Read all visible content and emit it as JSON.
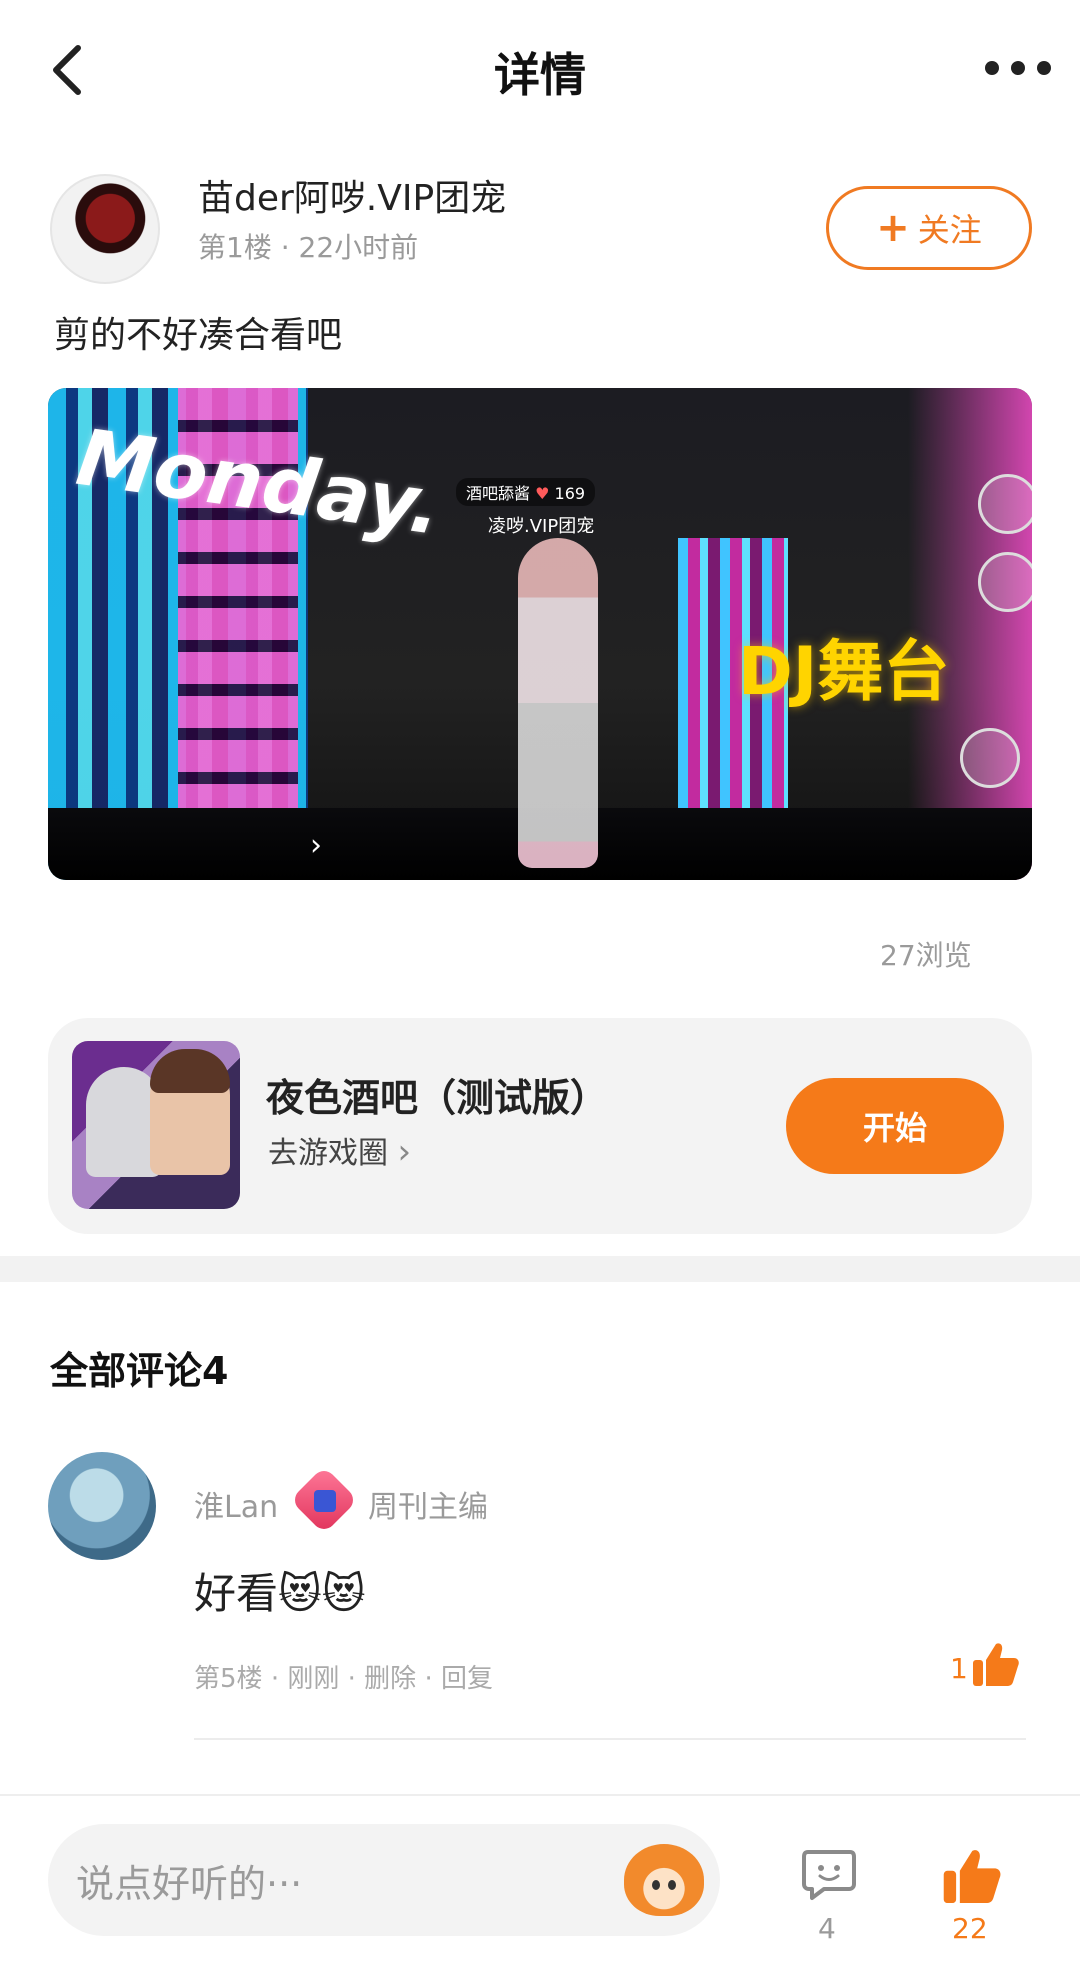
{
  "header": {
    "title": "详情"
  },
  "author": {
    "name": "苗der阿哕.VIP团宠",
    "floor": "第1楼",
    "time": "22小时前",
    "follow_label": "关注"
  },
  "post": {
    "text": "剪的不好凑合看吧",
    "media": {
      "overlay_text": "Monday.",
      "sign_text": "DJ舞台",
      "char_tag": "酒吧舔酱",
      "char_likes": "169",
      "char_name": "凌哕.VIP团宠"
    },
    "views": "27浏览"
  },
  "game": {
    "title": "夜色酒吧（测试版）",
    "link": "去游戏圈",
    "start_label": "开始"
  },
  "comments": {
    "title": "全部评论4",
    "items": [
      {
        "user": "淮Lan",
        "role": "周刊主编",
        "text": "好看😻😻",
        "floor": "第5楼",
        "time": "刚刚",
        "delete_label": "删除",
        "reply_label": "回复",
        "likes": "1"
      }
    ]
  },
  "bottom_bar": {
    "input_placeholder": "说点好听的···",
    "comment_count": "4",
    "like_count": "22"
  },
  "colors": {
    "accent": "#f57a19"
  },
  "icons": [
    "back-icon",
    "more-icon",
    "plus-icon",
    "chevron-right-icon",
    "thumb-up-icon",
    "chat-icon",
    "mascot-icon"
  ]
}
